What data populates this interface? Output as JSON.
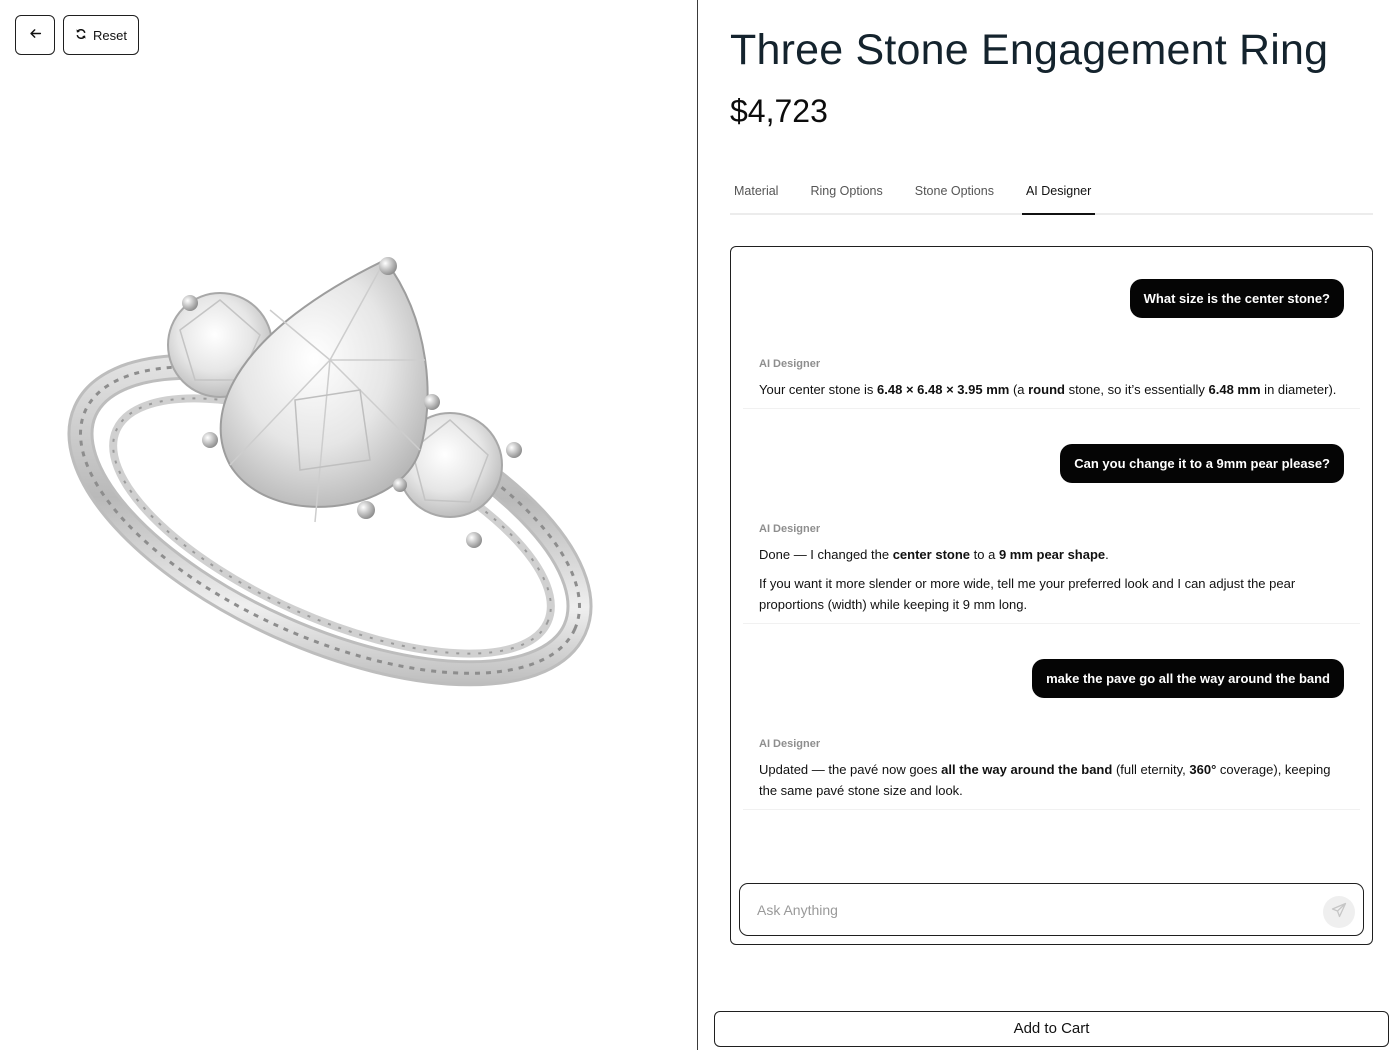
{
  "viewer": {
    "back_icon": "arrow-left-icon",
    "reset_icon": "refresh-icon",
    "reset_label": "Reset",
    "image": "three-stone-ring-render"
  },
  "product": {
    "title": "Three Stone Engagement Ring",
    "price": "$4,723"
  },
  "tabs": [
    {
      "label": "Material",
      "active": false
    },
    {
      "label": "Ring Options",
      "active": false
    },
    {
      "label": "Stone Options",
      "active": false
    },
    {
      "label": "AI Designer",
      "active": true
    }
  ],
  "chat": {
    "assistant_name": "AI Designer",
    "messages": [
      {
        "role": "user",
        "text": "What size is the center stone?"
      },
      {
        "role": "assistant",
        "paragraphs": [
          [
            "Your center stone is ",
            {
              "b": "6.48 × 6.48 × 3.95 mm"
            },
            " (a ",
            {
              "b": "round"
            },
            " stone, so it’s essentially ",
            {
              "b": "6.48 mm"
            },
            " in diameter)."
          ]
        ]
      },
      {
        "role": "user",
        "text": "Can you change it to a 9mm pear please?"
      },
      {
        "role": "assistant",
        "paragraphs": [
          [
            "Done — I changed the ",
            {
              "b": "center stone"
            },
            " to a ",
            {
              "b": "9 mm pear shape"
            },
            "."
          ],
          [
            "If you want it more slender or more wide, tell me your preferred look and I can adjust the pear proportions (width) while keeping it 9 mm long."
          ]
        ]
      },
      {
        "role": "user",
        "text": "make the pave go all the way around the band"
      },
      {
        "role": "assistant",
        "paragraphs": [
          [
            "Updated — the pavé now goes ",
            {
              "b": "all the way around the band"
            },
            " (full eternity, ",
            {
              "b": "360°"
            },
            " coverage), keeping the same pavé stone size and look."
          ]
        ]
      }
    ],
    "input_placeholder": "Ask Anything",
    "input_value": "",
    "send_icon": "send-icon"
  },
  "cart": {
    "label": "Add to Cart"
  }
}
